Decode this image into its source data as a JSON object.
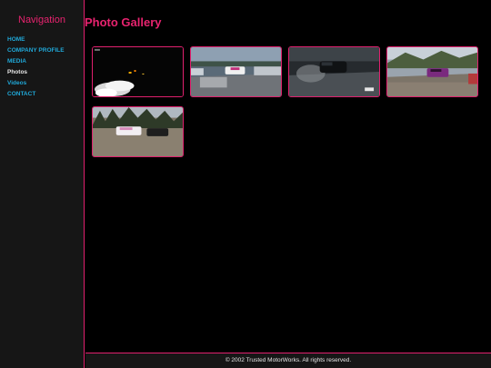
{
  "sidebar": {
    "title": "Navigation",
    "items": [
      {
        "label": "HOME"
      },
      {
        "label": "COMPANY PROFILE"
      },
      {
        "label": "MEDIA"
      },
      {
        "label": "Photos"
      },
      {
        "label": "Videos"
      },
      {
        "label": "CONTACT"
      }
    ]
  },
  "main": {
    "title": "Photo Gallery",
    "photos": [
      {
        "description": "night drift shot"
      },
      {
        "description": "drift car on track with barriers"
      },
      {
        "description": "dark car drifting at night"
      },
      {
        "description": "purple car on mountain road"
      },
      {
        "description": "white car drifting near trees"
      }
    ]
  },
  "footer": {
    "text": "© 2002 Trusted MotorWorks. All rights reserved."
  },
  "colors": {
    "accent": "#e8236f",
    "link": "#20a8d8",
    "active_link": "#e6e6e6",
    "sidebar_bg": "#161616",
    "page_bg": "#000000"
  }
}
